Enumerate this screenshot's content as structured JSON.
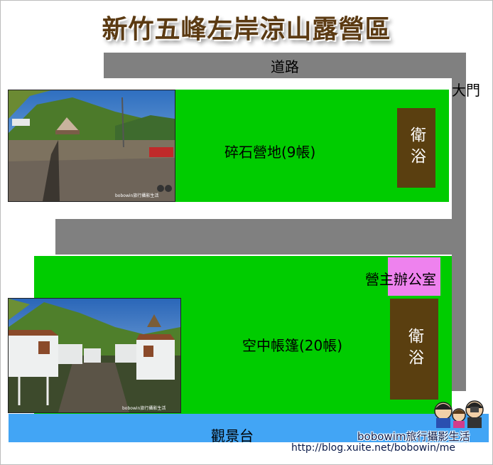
{
  "title": "新竹五峰左岸涼山露營區",
  "road_label": "道路",
  "gate_label": "大門",
  "upper_area": {
    "label": "碎石營地(9帳)",
    "bathroom_label": "衛浴"
  },
  "lower_area": {
    "label": "空中帳篷(20帳)",
    "bathroom_label": "衛浴",
    "office_label": "營主辦公室"
  },
  "viewing_deck_label": "觀景台",
  "photo_watermark": "bobowin旅行攝影生活",
  "credit": {
    "blog_name": "bobowim旅行攝影生活",
    "url": "http://blog.xuite.net/bobowin/me"
  },
  "colors": {
    "road": "#808080",
    "campsite": "#00cc00",
    "bathroom": "#5a3f10",
    "office": "#ee82ee",
    "viewing_deck": "#42a5f5",
    "title": "#5b3a12"
  }
}
